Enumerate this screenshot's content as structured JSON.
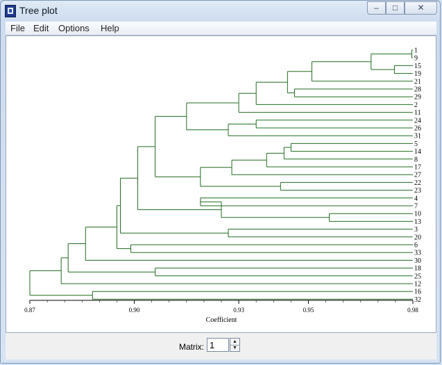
{
  "window": {
    "title": "Tree plot"
  },
  "menu": [
    "File",
    "Edit",
    "Options",
    "Help"
  ],
  "status": {
    "matrix_label": "Matrix:",
    "matrix_value": "1"
  },
  "chart_data": {
    "type": "dendrogram",
    "xlabel": "Coefficient",
    "xlim": [
      0.87,
      0.98
    ],
    "ticks": [
      "0.87",
      "0.90",
      "0.93",
      "0.95",
      "0.98"
    ],
    "tick_values": [
      0.87,
      0.9,
      0.93,
      0.95,
      0.98
    ],
    "color": "#1f6b1f",
    "leaves": [
      "1",
      "9",
      "15",
      "19",
      "21",
      "28",
      "29",
      "2",
      "11",
      "24",
      "26",
      "31",
      "5",
      "14",
      "8",
      "17",
      "27",
      "22",
      "23",
      "4",
      "7",
      "10",
      "13",
      "3",
      "20",
      "6",
      "33",
      "30",
      "18",
      "25",
      "12",
      "16",
      "32"
    ],
    "merges": [
      {
        "a": [
          "leaf",
          0
        ],
        "b": [
          "leaf",
          1
        ],
        "h": 0.9797
      },
      {
        "a": [
          "leaf",
          2
        ],
        "b": [
          "leaf",
          3
        ],
        "h": 0.9747
      },
      {
        "a": [
          "node",
          0
        ],
        "b": [
          "node",
          1
        ],
        "h": 0.968
      },
      {
        "a": [
          "node",
          2
        ],
        "b": [
          "leaf",
          4
        ],
        "h": 0.951
      },
      {
        "a": [
          "leaf",
          5
        ],
        "b": [
          "leaf",
          6
        ],
        "h": 0.946
      },
      {
        "a": [
          "node",
          3
        ],
        "b": [
          "node",
          4
        ],
        "h": 0.944
      },
      {
        "a": [
          "node",
          5
        ],
        "b": [
          "leaf",
          7
        ],
        "h": 0.935
      },
      {
        "a": [
          "node",
          6
        ],
        "b": [
          "leaf",
          8
        ],
        "h": 0.93
      },
      {
        "a": [
          "leaf",
          9
        ],
        "b": [
          "leaf",
          10
        ],
        "h": 0.935
      },
      {
        "a": [
          "node",
          8
        ],
        "b": [
          "leaf",
          11
        ],
        "h": 0.927
      },
      {
        "a": [
          "node",
          7
        ],
        "b": [
          "node",
          9
        ],
        "h": 0.915
      },
      {
        "a": [
          "leaf",
          12
        ],
        "b": [
          "leaf",
          13
        ],
        "h": 0.945
      },
      {
        "a": [
          "node",
          11
        ],
        "b": [
          "leaf",
          14
        ],
        "h": 0.943
      },
      {
        "a": [
          "node",
          12
        ],
        "b": [
          "leaf",
          15
        ],
        "h": 0.938
      },
      {
        "a": [
          "node",
          13
        ],
        "b": [
          "leaf",
          16
        ],
        "h": 0.928
      },
      {
        "a": [
          "leaf",
          17
        ],
        "b": [
          "leaf",
          18
        ],
        "h": 0.942
      },
      {
        "a": [
          "node",
          14
        ],
        "b": [
          "node",
          15
        ],
        "h": 0.919
      },
      {
        "a": [
          "node",
          10
        ],
        "b": [
          "node",
          16
        ],
        "h": 0.906
      },
      {
        "a": [
          "leaf",
          19
        ],
        "b": [
          "leaf",
          20
        ],
        "h": 0.919
      },
      {
        "a": [
          "leaf",
          21
        ],
        "b": [
          "leaf",
          22
        ],
        "h": 0.956
      },
      {
        "a": [
          "node",
          18
        ],
        "b": [
          "node",
          19
        ],
        "h": 0.925
      },
      {
        "a": [
          "node",
          17
        ],
        "b": [
          "node",
          20
        ],
        "h": 0.901
      },
      {
        "a": [
          "leaf",
          23
        ],
        "b": [
          "leaf",
          24
        ],
        "h": 0.927
      },
      {
        "a": [
          "node",
          21
        ],
        "b": [
          "node",
          22
        ],
        "h": 0.896
      },
      {
        "a": [
          "leaf",
          25
        ],
        "b": [
          "leaf",
          26
        ],
        "h": 0.899
      },
      {
        "a": [
          "node",
          23
        ],
        "b": [
          "node",
          24
        ],
        "h": 0.895
      },
      {
        "a": [
          "node",
          25
        ],
        "b": [
          "leaf",
          27
        ],
        "h": 0.886
      },
      {
        "a": [
          "leaf",
          28
        ],
        "b": [
          "leaf",
          29
        ],
        "h": 0.906
      },
      {
        "a": [
          "node",
          26
        ],
        "b": [
          "node",
          27
        ],
        "h": 0.881
      },
      {
        "a": [
          "node",
          28
        ],
        "b": [
          "leaf",
          30
        ],
        "h": 0.879
      },
      {
        "a": [
          "leaf",
          31
        ],
        "b": [
          "leaf",
          32
        ],
        "h": 0.888
      },
      {
        "a": [
          "node",
          29
        ],
        "b": [
          "node",
          30
        ],
        "h": 0.87
      }
    ]
  }
}
